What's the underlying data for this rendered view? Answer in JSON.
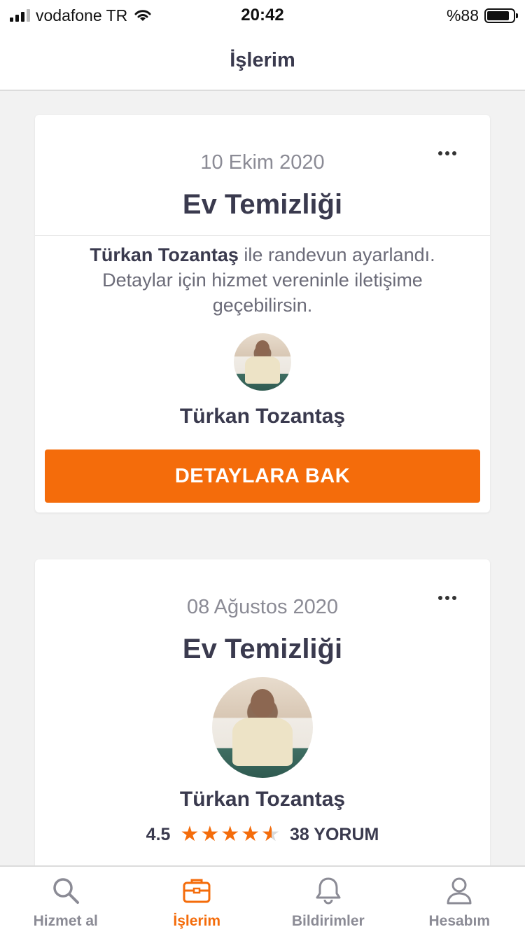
{
  "status": {
    "carrier": "vodafone TR",
    "time": "20:42",
    "battery": "%88"
  },
  "header": {
    "title": "İşlerim"
  },
  "jobs": [
    {
      "date": "10 Ekim 2020",
      "service": "Ev Temizliği",
      "message_name": "Türkan Tozantaş",
      "message_line1": " ile randevun ayarlandı.",
      "message_line2": "Detaylar için hizmet vereninle iletişime geçebilirsin.",
      "provider_name": "Türkan Tozantaş",
      "cta_label": "DETAYLARA BAK"
    },
    {
      "date": "08 Ağustos 2020",
      "service": "Ev Temizliği",
      "provider_name": "Türkan Tozantaş",
      "rating": "4.5",
      "reviews": "38 YORUM"
    }
  ],
  "tabs": [
    {
      "label": "Hizmet al",
      "icon": "search-icon"
    },
    {
      "label": "İşlerim",
      "icon": "briefcase-icon",
      "active": true
    },
    {
      "label": "Bildirimler",
      "icon": "bell-icon"
    },
    {
      "label": "Hesabım",
      "icon": "user-icon"
    }
  ],
  "colors": {
    "accent": "#f46c0b",
    "text": "#3a3a4e",
    "muted": "#8b8b95"
  }
}
